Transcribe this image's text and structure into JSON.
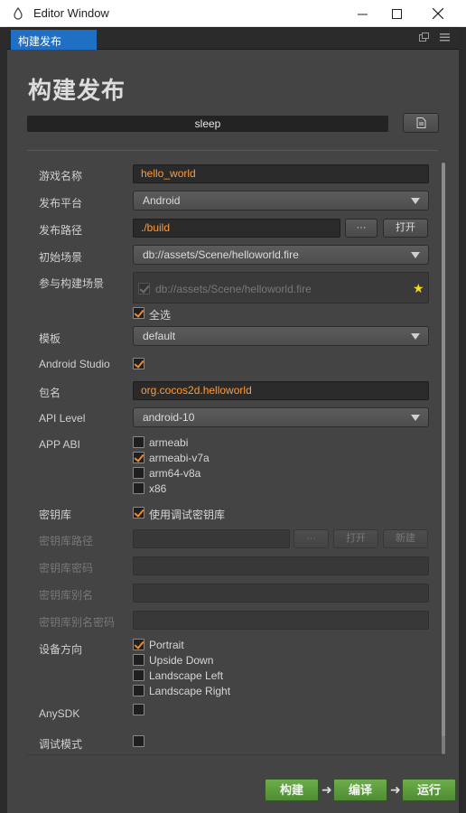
{
  "window": {
    "title": "Editor Window"
  },
  "tab": {
    "label": "构建发布"
  },
  "panel": {
    "heading": "构建发布",
    "title_value": "sleep"
  },
  "form": {
    "game_name": {
      "label": "游戏名称",
      "value": "hello_world"
    },
    "platform": {
      "label": "发布平台",
      "value": "Android"
    },
    "path": {
      "label": "发布路径",
      "value": "./build",
      "browse": "···",
      "open": "打开"
    },
    "start_scene": {
      "label": "初始场景",
      "value": "db://assets/Scene/helloworld.fire"
    },
    "build_scenes": {
      "label": "参与构建场景",
      "scene": "db://assets/Scene/helloworld.fire",
      "select_all": "全选"
    },
    "template": {
      "label": "模板",
      "value": "default"
    },
    "android_studio": {
      "label": "Android Studio"
    },
    "package": {
      "label": "包名",
      "value": "org.cocos2d.helloworld"
    },
    "api_level": {
      "label": "API Level",
      "value": "android-10"
    },
    "app_abi": {
      "label": "APP ABI",
      "options": [
        "armeabi",
        "armeabi-v7a",
        "arm64-v8a",
        "x86"
      ]
    },
    "keystore": {
      "label": "密钥库",
      "use_debug": "使用调试密钥库"
    },
    "keystore_path": {
      "label": "密钥库路径",
      "browse": "···",
      "open": "打开",
      "new": "新建"
    },
    "keystore_password": {
      "label": "密钥库密码"
    },
    "keystore_alias": {
      "label": "密钥库别名"
    },
    "keystore_alias_password": {
      "label": "密钥库别名密码"
    },
    "orientation": {
      "label": "设备方向",
      "options": [
        "Portrait",
        "Upside Down",
        "Landscape Left",
        "Landscape Right"
      ]
    },
    "anysdk": {
      "label": "AnySDK"
    },
    "debug": {
      "label": "调试模式"
    }
  },
  "actions": {
    "build": "构建",
    "compile": "编译",
    "run": "运行"
  },
  "colors": {
    "accent": "#1f6fc5",
    "input_text": "#ff9a3c",
    "check": "#f08a24",
    "action_green": "#5a9a3c"
  }
}
